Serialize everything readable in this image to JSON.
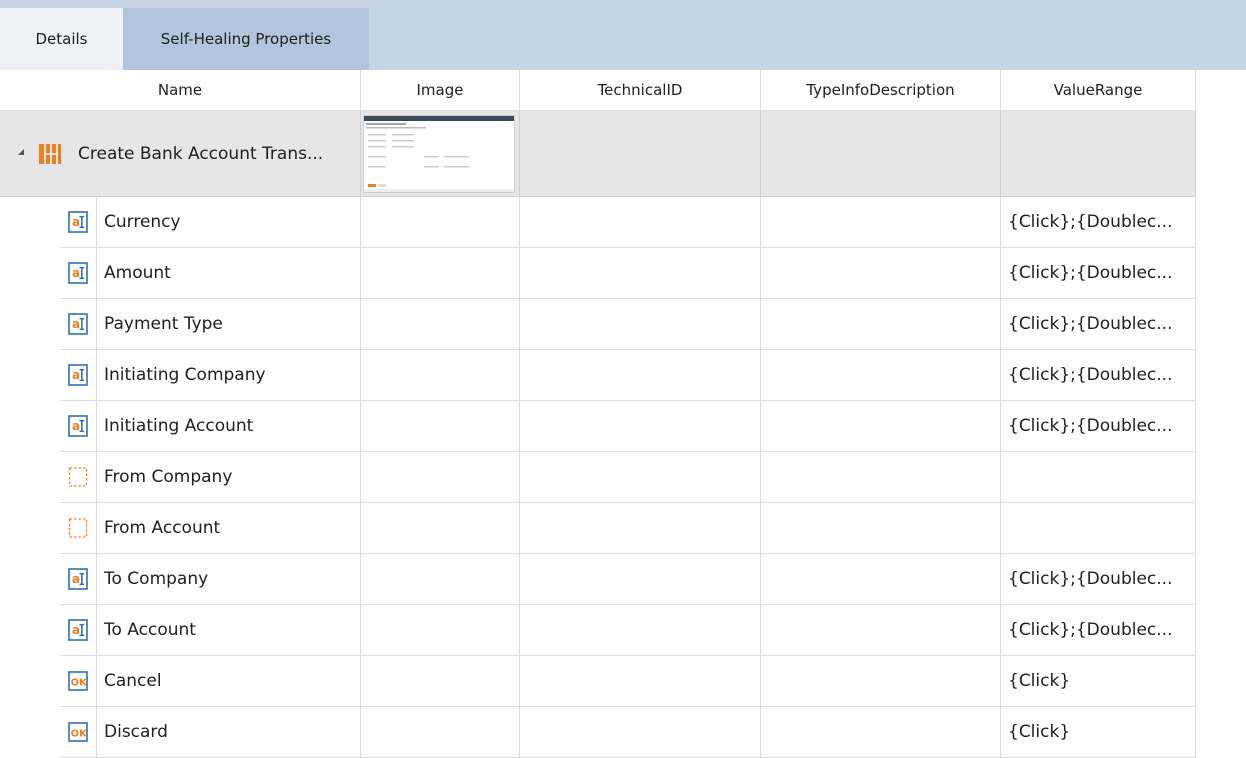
{
  "tabs": [
    {
      "label": "Details",
      "active": true
    },
    {
      "label": "Self-Healing Properties",
      "active": false
    }
  ],
  "columns": [
    "Name",
    "Image",
    "TechnicalID",
    "TypeInfoDescription",
    "ValueRange"
  ],
  "group": {
    "name": "Create Bank Account Trans...",
    "icon": "module-icon",
    "expanded": true
  },
  "rows": [
    {
      "name": "Currency",
      "icon": "textbox-icon",
      "value_range": "{Click};{Doublec..."
    },
    {
      "name": "Amount",
      "icon": "textbox-icon",
      "value_range": "{Click};{Doublec..."
    },
    {
      "name": "Payment Type",
      "icon": "textbox-icon",
      "value_range": "{Click};{Doublec..."
    },
    {
      "name": "Initiating Company",
      "icon": "textbox-icon",
      "value_range": "{Click};{Doublec..."
    },
    {
      "name": "Initiating Account",
      "icon": "textbox-icon",
      "value_range": "{Click};{Doublec..."
    },
    {
      "name": "From Company",
      "icon": "container-icon",
      "value_range": ""
    },
    {
      "name": "From Account",
      "icon": "container-icon",
      "value_range": ""
    },
    {
      "name": "To Company",
      "icon": "textbox-icon",
      "value_range": "{Click};{Doublec..."
    },
    {
      "name": "To Account",
      "icon": "textbox-icon",
      "value_range": "{Click};{Doublec..."
    },
    {
      "name": "Cancel",
      "icon": "button-icon",
      "value_range": "{Click}"
    },
    {
      "name": "Discard",
      "icon": "button-icon",
      "value_range": "{Click}"
    }
  ],
  "colors": {
    "accent_orange": "#f0801e",
    "icon_blue": "#2d6fb6",
    "tab_bar": "#c6d4e6"
  }
}
